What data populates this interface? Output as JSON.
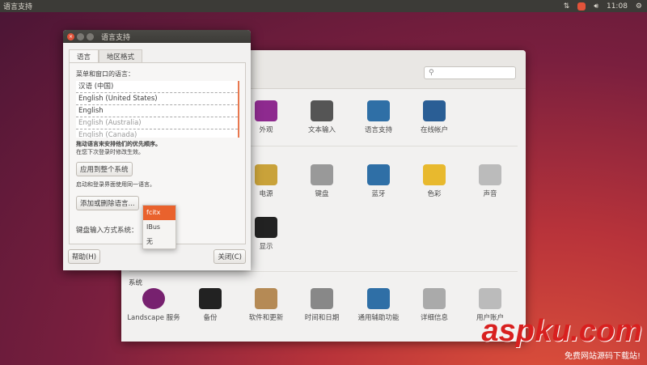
{
  "panel": {
    "title": "语言支持",
    "time": "11:08"
  },
  "settings": {
    "search_placeholder": "",
    "row1": [
      "外观",
      "文本输入",
      "语言支持",
      "在线帐户"
    ],
    "row2": [
      "电源",
      "键盘",
      "蓝牙",
      "色彩",
      "声音"
    ],
    "row3": [
      "显示"
    ],
    "system_heading": "系统",
    "system": [
      "Landscape 服务",
      "备份",
      "软件和更新",
      "时间和日期",
      "通用辅助功能",
      "详细信息",
      "用户账户"
    ]
  },
  "dialog": {
    "title": "语言支持",
    "tabs": [
      "语言",
      "地区格式"
    ],
    "menu_lang_label": "菜单和窗口的语言：",
    "languages": [
      "汉语 (中国)",
      "English (United States)",
      "English",
      "English (Australia)",
      "English (Canada)"
    ],
    "drag_hint": "拖动语言来安排他们的优先顺序。",
    "effect_hint": "在您下次登录时修改生效。",
    "apply_button": "应用到整个系统",
    "apply_hint": "启动和登录界面使用同一语言。",
    "add_remove_button": "添加或删除语言...",
    "im_label": "键盘输入方式系统：",
    "im_options": [
      "fcitx",
      "IBus",
      "无"
    ],
    "help_button": "帮助(H)",
    "close_button": "关闭(C)"
  },
  "watermark": {
    "text": "aspku.com",
    "sub": "免费网站源码下载站!"
  },
  "colors": {
    "accent": "#e9622d",
    "panel": "#3c3b37"
  }
}
